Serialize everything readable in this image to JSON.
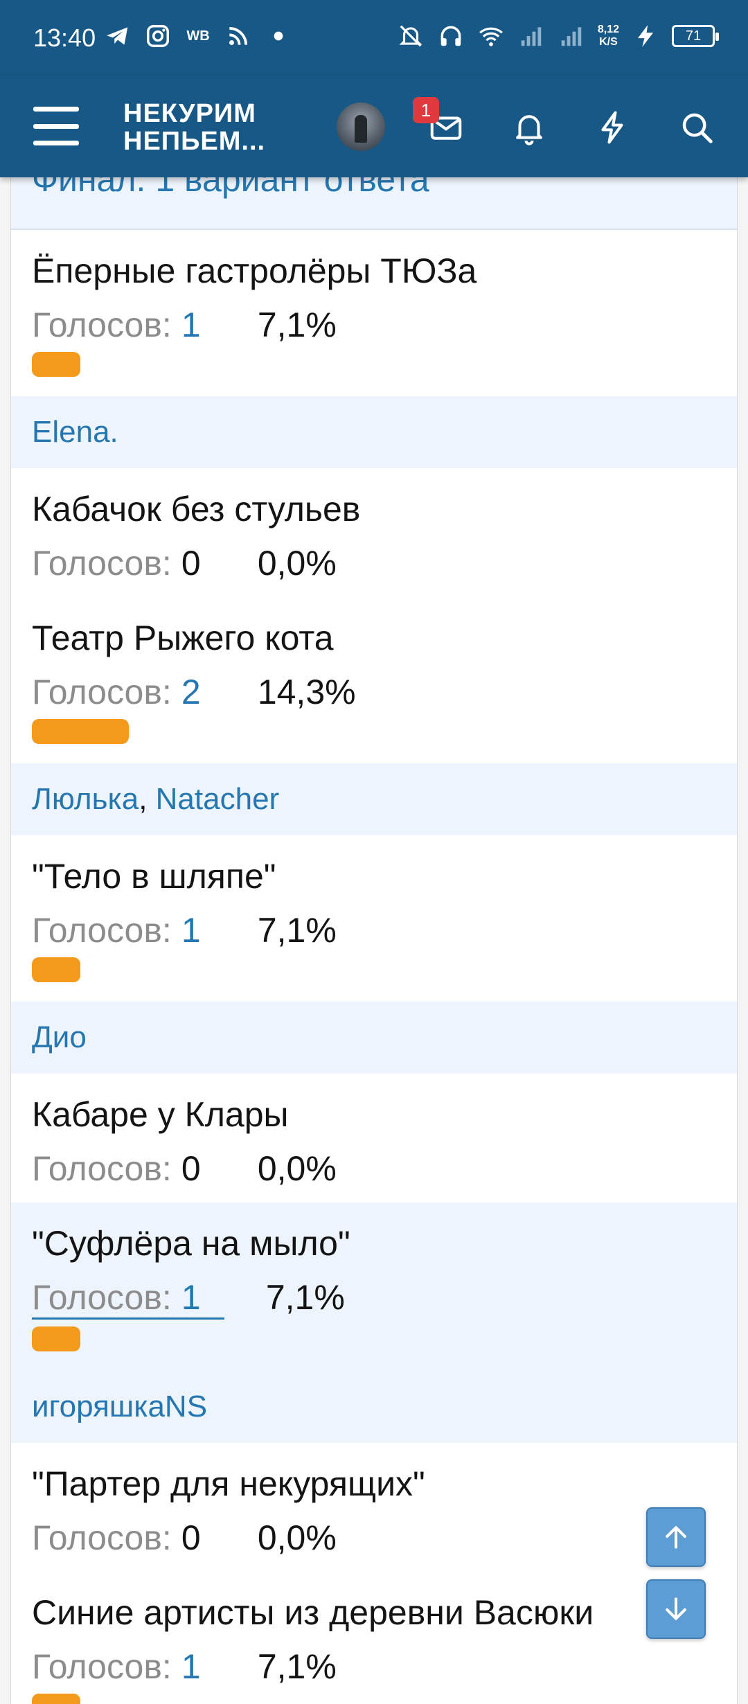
{
  "status_bar": {
    "time": "13:40",
    "wb_label": "WB",
    "net_speed_value": "8,12",
    "net_speed_unit": "K/S",
    "battery": "71"
  },
  "header": {
    "logo_line1": "НЕКУРИМ",
    "logo_line2": "НЕПЬЕМ...",
    "mail_badge": "1"
  },
  "poll": {
    "heading": "Финал. 1 вариант ответа",
    "votes_label": "Голосов:",
    "options": [
      {
        "title": "Ёперные гастролёры ТЮЗа",
        "votes": "1",
        "percent": "7,1%",
        "share": 0.071,
        "voters": [
          "Elena."
        ]
      },
      {
        "title": "Кабачок без стульев",
        "votes": "0",
        "percent": "0,0%",
        "share": 0.0,
        "voters": []
      },
      {
        "title": "Театр Рыжего кота",
        "votes": "2",
        "percent": "14,3%",
        "share": 0.143,
        "voters": [
          "Люлька",
          "Natacher"
        ]
      },
      {
        "title": "\"Тело в шляпе\"",
        "votes": "1",
        "percent": "7,1%",
        "share": 0.071,
        "voters": [
          "Дио"
        ]
      },
      {
        "title": "Кабаре у Клары",
        "votes": "0",
        "percent": "0,0%",
        "share": 0.0,
        "voters": []
      },
      {
        "title": "\"Суфлёра на мыло\"",
        "votes": "1",
        "percent": "7,1%",
        "share": 0.071,
        "voters": [
          "игоряшкаNS"
        ]
      },
      {
        "title": "\"Партер для некурящих\"",
        "votes": "0",
        "percent": "0,0%",
        "share": 0.0,
        "voters": []
      },
      {
        "title": "Синие артисты из деревни Васюки",
        "votes": "1",
        "percent": "7,1%",
        "share": 0.071,
        "voters": []
      }
    ]
  },
  "icons": {
    "menu": "hamburger-icon",
    "mail": "envelope-icon",
    "bell": "bell-icon",
    "bolt": "lightning-icon",
    "search": "search-icon",
    "scroll_up": "arrow-up-icon",
    "scroll_down": "arrow-down-icon"
  },
  "colors": {
    "header_bg": "#185886",
    "link": "#2577b1",
    "bar": "#f39a1b",
    "voters_bg": "#edf4fb",
    "badge": "#e0393e"
  }
}
